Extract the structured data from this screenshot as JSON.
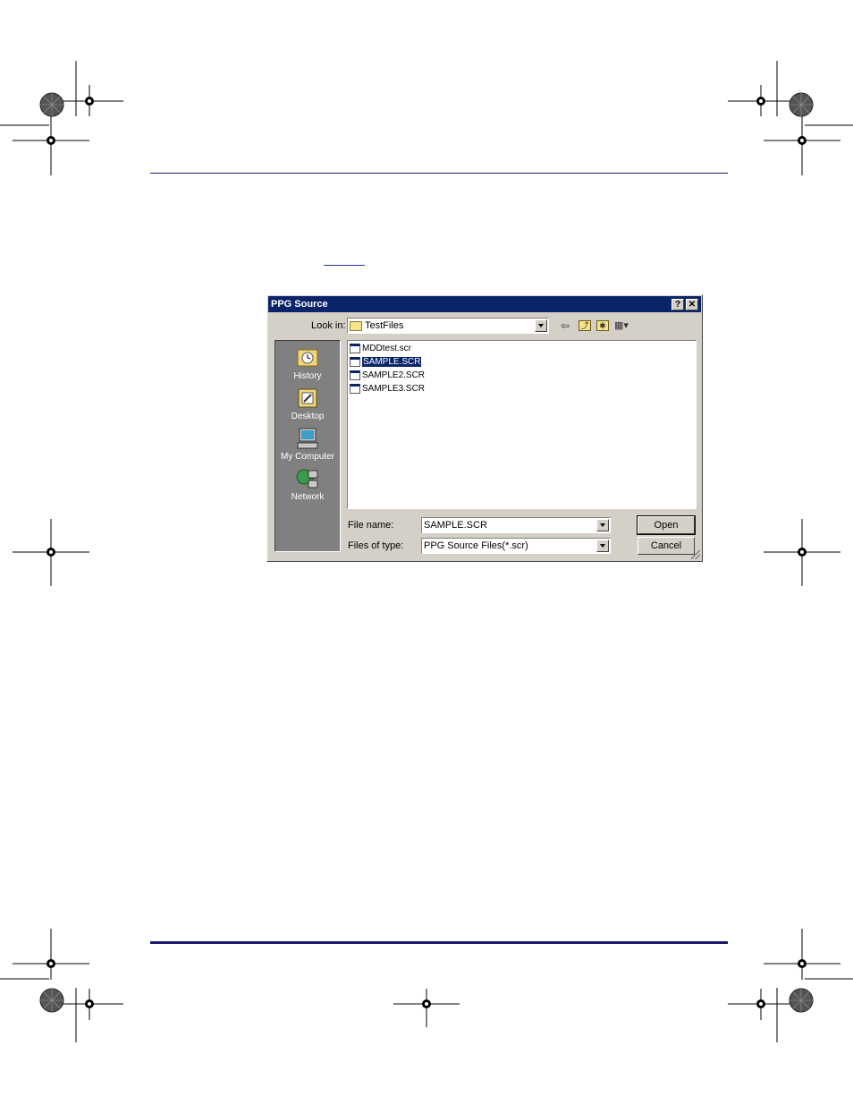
{
  "dialog": {
    "title": "PPG Source",
    "help_label": "?",
    "close_label": "✕",
    "look_in_label": "Look in:",
    "look_in_value": "TestFiles",
    "places": [
      {
        "label": "History",
        "icon": "history-icon"
      },
      {
        "label": "Desktop",
        "icon": "desktop-icon"
      },
      {
        "label": "My Computer",
        "icon": "my-computer-icon"
      },
      {
        "label": "Network",
        "icon": "network-icon"
      }
    ],
    "files": [
      {
        "name": "MDDtest.scr",
        "selected": false
      },
      {
        "name": "SAMPLE.SCR",
        "selected": true
      },
      {
        "name": "SAMPLE2.SCR",
        "selected": false
      },
      {
        "name": "SAMPLE3.SCR",
        "selected": false
      }
    ],
    "file_name_label": "File name:",
    "file_name_value": "SAMPLE.SCR",
    "file_type_label": "Files of type:",
    "file_type_value": "PPG Source Files(*.scr)",
    "open_label": "Open",
    "cancel_label": "Cancel",
    "toolbar": {
      "back_glyph": "⇦",
      "up_glyph": "⤴",
      "new_folder_glyph": "✱",
      "views_glyph": "▦▾"
    }
  },
  "colors": {
    "titlebar": "#0a246a",
    "rule": "#1a1a6e",
    "dialog_face": "#d4d0c8"
  }
}
